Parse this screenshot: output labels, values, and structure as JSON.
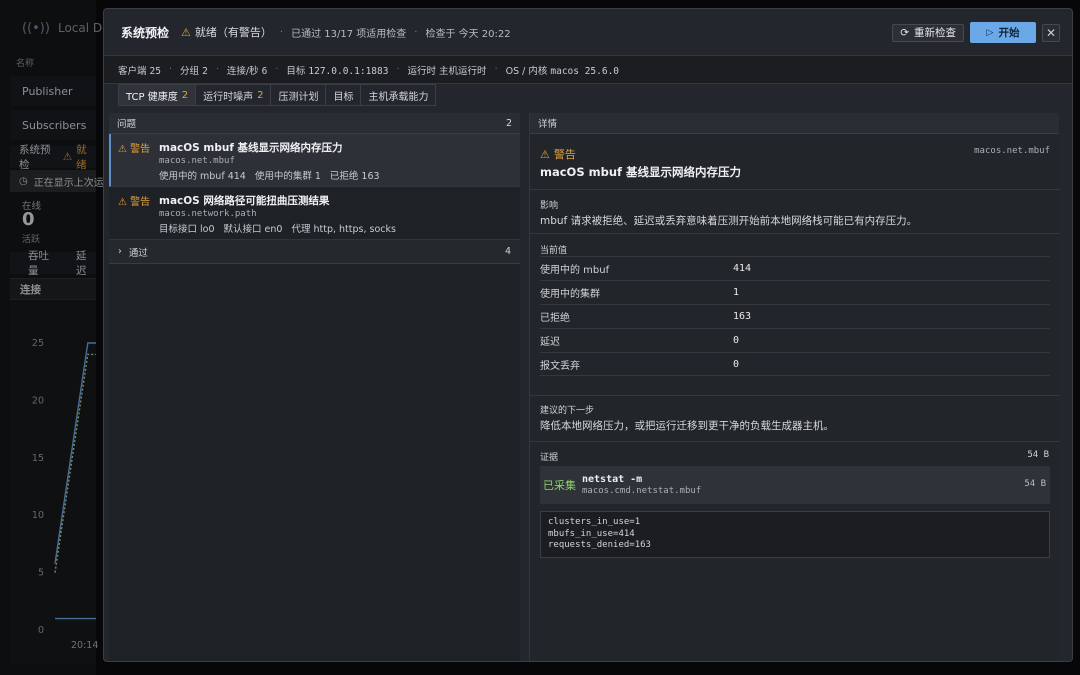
{
  "background_app": {
    "title": "Local Demo",
    "name_column": "名称",
    "nav_items": [
      {
        "label": "Publisher"
      },
      {
        "label": "Subscribers"
      }
    ],
    "preflight_label": "系统预检",
    "preflight_status": "就绪",
    "notice_text": "正在显示上次运",
    "online_label": "在线",
    "online_value": "0",
    "active_label": "活跃",
    "metric_tabs": [
      "吞吐量",
      "延迟"
    ],
    "connections_label": "连接",
    "chart_data": {
      "type": "line",
      "y_ticks": [
        "25",
        "20",
        "15",
        "10",
        "5",
        "0"
      ],
      "x_ticks": [
        "20:14"
      ],
      "ylim": [
        0,
        27
      ],
      "series": [
        {
          "points": [
            [
              0,
              5.8
            ],
            [
              0.8,
              25
            ],
            [
              1,
              25
            ]
          ],
          "color": "#6ea6e6",
          "style": "solid"
        },
        {
          "points": [
            [
              0,
              5
            ],
            [
              0.8,
              24
            ],
            [
              1,
              24
            ]
          ],
          "color": "#b8d89a",
          "style": "dotted"
        },
        {
          "points": [
            [
              0,
              1
            ],
            [
              1,
              1
            ]
          ],
          "color": "#6ea6e6",
          "style": "solid"
        }
      ]
    }
  },
  "modal": {
    "title": "系统预检",
    "status": "就绪（有警告）",
    "passed_text": "已通过 13/17 项适用检查",
    "checked_text": "检查于 今天 20:22",
    "recheck_label": "重新检查",
    "start_label": "开始",
    "close_glyph": "✕",
    "stats": [
      {
        "label": "客户端",
        "value": "25"
      },
      {
        "label": "分组",
        "value": "2"
      },
      {
        "label": "连接/秒",
        "value": "6"
      },
      {
        "label": "目标",
        "value": "127.0.0.1:1883"
      },
      {
        "label": "运行时",
        "value": "主机运行时"
      },
      {
        "label": "OS / 内核",
        "value": "macos 25.6.0"
      }
    ],
    "tabs": [
      {
        "label": "TCP 健康度",
        "count": "2"
      },
      {
        "label": "运行时噪声",
        "count": "2"
      },
      {
        "label": "压测计划",
        "count": ""
      },
      {
        "label": "目标",
        "count": ""
      },
      {
        "label": "主机承载能力",
        "count": ""
      }
    ],
    "issues": {
      "header": "问题",
      "count": "2",
      "items": [
        {
          "severity": "警告",
          "title": "macOS mbuf 基线显示网络内存压力",
          "id": "macos.net.mbuf",
          "facts": [
            "使用中的 mbuf 414",
            "使用中的集群 1",
            "已拒绝 163"
          ]
        },
        {
          "severity": "警告",
          "title": "macOS 网络路径可能扭曲压测结果",
          "id": "macos.network.path",
          "facts": [
            "目标接口 lo0",
            "默认接口 en0",
            "代理 http, https, socks"
          ]
        }
      ],
      "passed_label": "通过",
      "passed_count": "4"
    },
    "details": {
      "header": "详情",
      "severity": "警告",
      "id": "macos.net.mbuf",
      "title": "macOS mbuf 基线显示网络内存压力",
      "impact_label": "影响",
      "impact_text": "mbuf 请求被拒绝、延迟或丢弃意味着压测开始前本地网络栈可能已有内存压力。",
      "current_label": "当前值",
      "values": [
        {
          "k": "使用中的 mbuf",
          "v": "414"
        },
        {
          "k": "使用中的集群",
          "v": "1"
        },
        {
          "k": "已拒绝",
          "v": "163"
        },
        {
          "k": "延迟",
          "v": "0"
        },
        {
          "k": "报文丢弃",
          "v": "0"
        }
      ],
      "next_label": "建议的下一步",
      "next_text": "降低本地网络压力，或把运行迁移到更干净的负载生成器主机。",
      "evidence_label": "证据",
      "evidence_size": "54 B",
      "evidence": {
        "status": "已采集",
        "command": "netstat -m",
        "path": "macos.cmd.netstat.mbuf",
        "size": "54 B",
        "output": "clusters_in_use=1\nmbufs_in_use=414\nrequests_denied=163"
      }
    }
  },
  "colors": {
    "warning": "#e3a33c",
    "accent": "#6aa8e8",
    "success": "#8fd16a"
  }
}
